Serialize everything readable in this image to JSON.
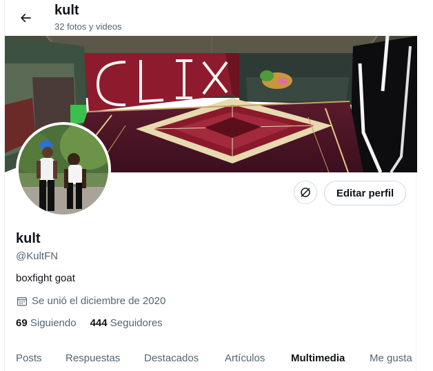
{
  "header": {
    "title": "kult",
    "subtitle": "32 fotos y videos"
  },
  "banner": {
    "sign_text": "CLIX"
  },
  "actions": {
    "edit_profile_label": "Editar perfil"
  },
  "profile": {
    "name": "kult",
    "handle": "@KultFN",
    "bio": "boxfight goat",
    "joined": "Se unió el diciembre de 2020",
    "following_count": "69",
    "following_label": "Siguiendo",
    "followers_count": "444",
    "followers_label": "Seguidores"
  },
  "tabs": [
    {
      "label": "Posts",
      "active": false
    },
    {
      "label": "Respuestas",
      "active": false
    },
    {
      "label": "Destacados",
      "active": false
    },
    {
      "label": "Artículos",
      "active": false
    },
    {
      "label": "Multimedia",
      "active": true
    },
    {
      "label": "Me gusta",
      "active": false
    }
  ],
  "colors": {
    "text": "#0f1419",
    "muted": "#536471",
    "border": "#cfd9de"
  },
  "icons": {
    "back": "arrow-left-icon",
    "unfollow_list": "eye-slash-circle-icon",
    "calendar": "calendar-icon"
  }
}
